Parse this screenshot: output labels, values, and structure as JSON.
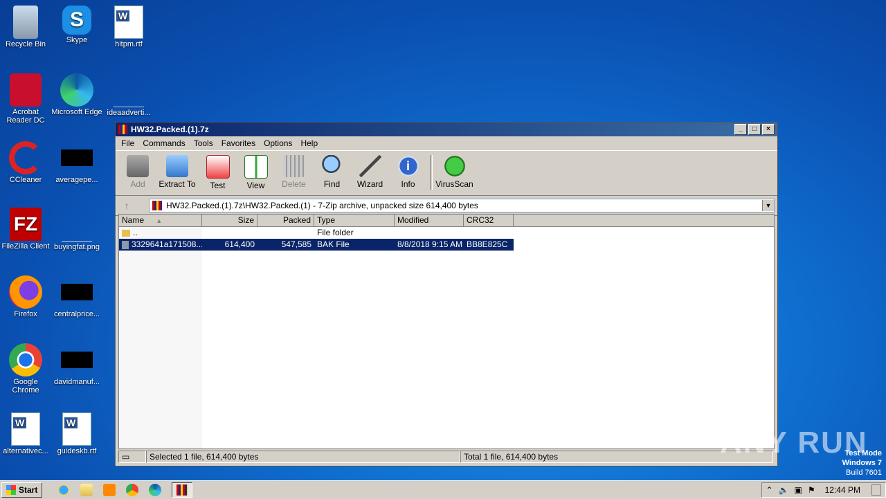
{
  "desktop": {
    "icons": [
      {
        "label": "Recycle Bin"
      },
      {
        "label": "Skype"
      },
      {
        "label": "hitpm.rtf"
      },
      {
        "label": "Acrobat Reader DC"
      },
      {
        "label": "Microsoft Edge"
      },
      {
        "label": "ideaadverti..."
      },
      {
        "label": "CCleaner"
      },
      {
        "label": "averagepe..."
      },
      {
        "label": "FileZilla Client"
      },
      {
        "label": "buyingfat.png"
      },
      {
        "label": "Firefox"
      },
      {
        "label": "centralprice..."
      },
      {
        "label": "Google Chrome"
      },
      {
        "label": "davidmanuf..."
      },
      {
        "label": "alternativec..."
      },
      {
        "label": "guideskb.rtf"
      }
    ]
  },
  "window": {
    "title": "HW32.Packed.(1).7z",
    "menu": [
      "File",
      "Commands",
      "Tools",
      "Favorites",
      "Options",
      "Help"
    ],
    "toolbar": [
      {
        "label": "Add",
        "icon": "add-icon",
        "disabled": true
      },
      {
        "label": "Extract To",
        "icon": "extract-icon",
        "disabled": false
      },
      {
        "label": "Test",
        "icon": "test-icon",
        "disabled": false
      },
      {
        "label": "View",
        "icon": "view-icon",
        "disabled": false
      },
      {
        "label": "Delete",
        "icon": "delete-icon",
        "disabled": true
      },
      {
        "label": "Find",
        "icon": "find-icon",
        "disabled": false
      },
      {
        "label": "Wizard",
        "icon": "wizard-icon",
        "disabled": false
      },
      {
        "label": "Info",
        "icon": "info-icon",
        "disabled": false
      },
      {
        "label": "VirusScan",
        "icon": "virusscan-icon",
        "disabled": false
      }
    ],
    "address": "HW32.Packed.(1).7z\\HW32.Packed.(1) - 7-Zip archive, unpacked size 614,400 bytes",
    "columns": {
      "name": "Name",
      "size": "Size",
      "packed": "Packed",
      "type": "Type",
      "modified": "Modified",
      "crc": "CRC32"
    },
    "rows": [
      {
        "name": "..",
        "size": "",
        "packed": "",
        "type": "File folder",
        "modified": "",
        "crc": ""
      },
      {
        "name": "3329641a171508...",
        "size": "614,400",
        "packed": "547,585",
        "type": "BAK File",
        "modified": "8/8/2018 9:15 AM",
        "crc": "BB8E825C"
      }
    ],
    "status_left": "Selected 1 file, 614,400 bytes",
    "status_right": "Total 1 file, 614,400 bytes"
  },
  "taskbar": {
    "start": "Start",
    "clock": "12:44 PM"
  },
  "overlay": {
    "watermark": "ANY RUN",
    "testmode_1": "Test Mode",
    "testmode_2": "Windows 7",
    "testmode_3": "Build 7601"
  }
}
